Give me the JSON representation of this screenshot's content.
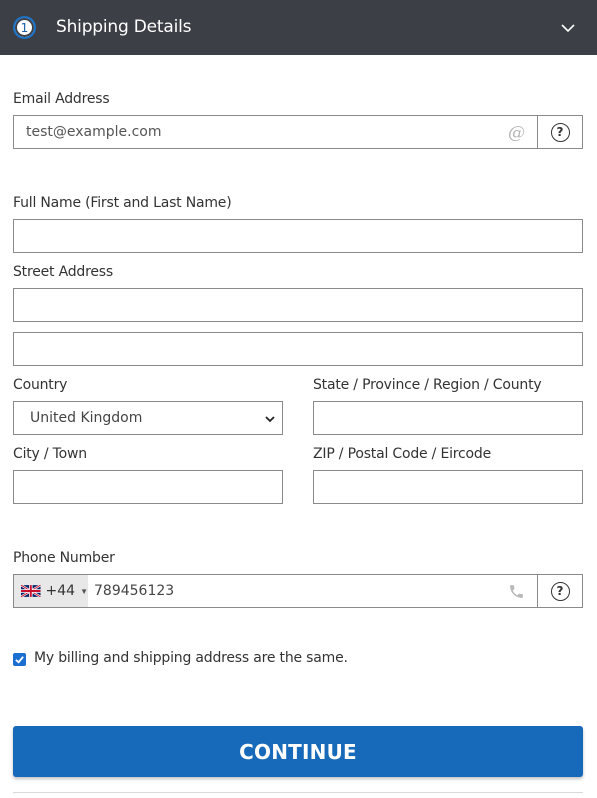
{
  "header": {
    "step_number": "1",
    "title": "Shipping Details",
    "toggle_icon": "chevron-down-icon"
  },
  "form": {
    "email": {
      "label": "Email Address",
      "value": "test@example.com",
      "icon": "at-sign-icon",
      "help": "?"
    },
    "full_name": {
      "label": "Full Name (First and Last Name)",
      "value": ""
    },
    "street": {
      "label": "Street Address",
      "line1": "",
      "line2": ""
    },
    "country": {
      "label": "Country",
      "selected": "United Kingdom"
    },
    "state": {
      "label": "State / Province / Region / County",
      "value": ""
    },
    "city": {
      "label": "City / Town",
      "value": ""
    },
    "zip": {
      "label": "ZIP / Postal Code / Eircode",
      "value": ""
    },
    "phone": {
      "label": "Phone Number",
      "flag": "uk-flag-icon",
      "dial_code": "+44",
      "value": "789456123",
      "icon": "phone-icon",
      "help": "?"
    },
    "same_address": {
      "label": "My billing and shipping address are the same.",
      "checked": true
    }
  },
  "actions": {
    "continue_label": "CONTINUE"
  },
  "colors": {
    "header_bg": "#3c3f46",
    "primary": "#1769b9",
    "checkbox": "#1a6fd1"
  }
}
